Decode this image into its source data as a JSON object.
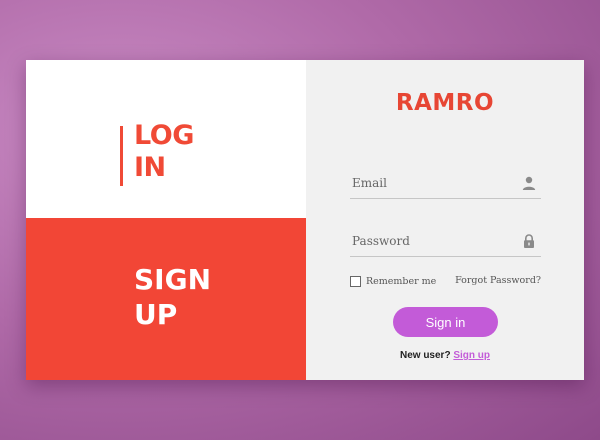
{
  "left_panel": {
    "login": {
      "line1": "LOG",
      "line2": "IN"
    },
    "signup": {
      "line1": "SIGN",
      "line2": "UP"
    }
  },
  "form": {
    "brand": "RAMRO",
    "email": {
      "placeholder": "Email",
      "value": "",
      "icon": "user-icon"
    },
    "password": {
      "placeholder": "Password",
      "value": "",
      "icon": "lock-icon"
    },
    "remember_label": "Remember me",
    "remember_checked": false,
    "forgot_label": "Forgot Password?",
    "signin_label": "Sign in",
    "new_user_text": "New user?",
    "signup_link": "Sign up"
  },
  "colors": {
    "accent_red": "#f24636",
    "brand_red": "#e74634",
    "button_purple": "#c35bd8",
    "background": "#b06aa8"
  }
}
